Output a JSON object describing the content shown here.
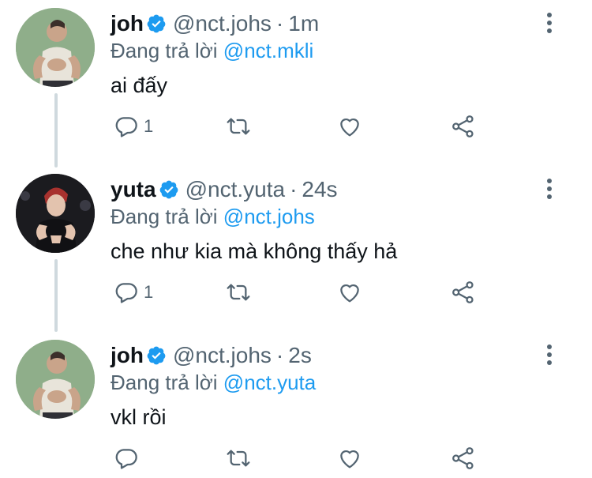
{
  "tweets": [
    {
      "name": "joh",
      "handle": "@nct.johs",
      "separator": "·",
      "time": "1m",
      "reply_prefix": "Đang trả lời",
      "reply_to": "@nct.mkli",
      "text": "ai đấy",
      "reply_count": "1",
      "avatar_bg": "#8fae8a"
    },
    {
      "name": "yuta",
      "handle": "@nct.yuta",
      "separator": "·",
      "time": "24s",
      "reply_prefix": "Đang trả lời",
      "reply_to": "@nct.johs",
      "text": "che như kia mà không thấy hả",
      "reply_count": "1",
      "avatar_bg": "#1b1b1f"
    },
    {
      "name": "joh",
      "handle": "@nct.johs",
      "separator": "·",
      "time": "2s",
      "reply_prefix": "Đang trả lời",
      "reply_to": "@nct.yuta",
      "text": "vkl rồi",
      "reply_count": "",
      "avatar_bg": "#8fae8a"
    }
  ],
  "icons": {
    "verified": "verified-badge-icon",
    "reply": "reply-icon",
    "retweet": "retweet-icon",
    "like": "heart-icon",
    "share": "share-icon",
    "more": "more-vertical-icon"
  },
  "colors": {
    "accent": "#1d9bf0",
    "muted": "#536471",
    "text": "#0f1419",
    "thread_line": "#cfd9de"
  }
}
